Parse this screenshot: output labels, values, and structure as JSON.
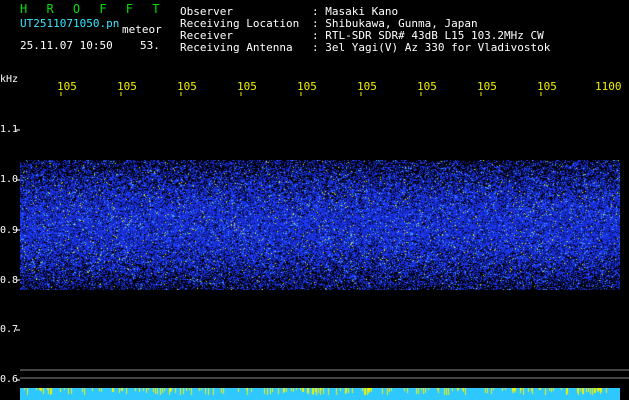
{
  "header": {
    "logo": "H R O F F T",
    "filename": "UT2511071050.pn",
    "type": "meteor",
    "datetime": "25.11.07 10:50",
    "value": "53."
  },
  "info": {
    "labels": [
      "Observer",
      "Receiving Location",
      "Receiver",
      "Receiving Antenna"
    ],
    "values": [
      ": Masaki Kano",
      ": Shibukawa, Gunma, Japan",
      ": RTL-SDR SDR# 43dB L15 103.2MHz CW",
      ": 3el Yagi(V) Az 330 for Vladivostok"
    ]
  },
  "axis": {
    "unit": "kHz",
    "x_ticks": [
      "105",
      "105",
      "105",
      "105",
      "105",
      "105",
      "105",
      "105",
      "105",
      "1100"
    ],
    "y_ticks": [
      "1.1",
      "1.0",
      "0.9",
      "0.8",
      "0.7",
      "0.6"
    ]
  },
  "colors": {
    "background": "#000000",
    "noise": "#1e3cff",
    "noise_bright": "#4aa8ff",
    "baseline": "#2ec8ff",
    "grid_line": "#8a8a8a"
  }
}
